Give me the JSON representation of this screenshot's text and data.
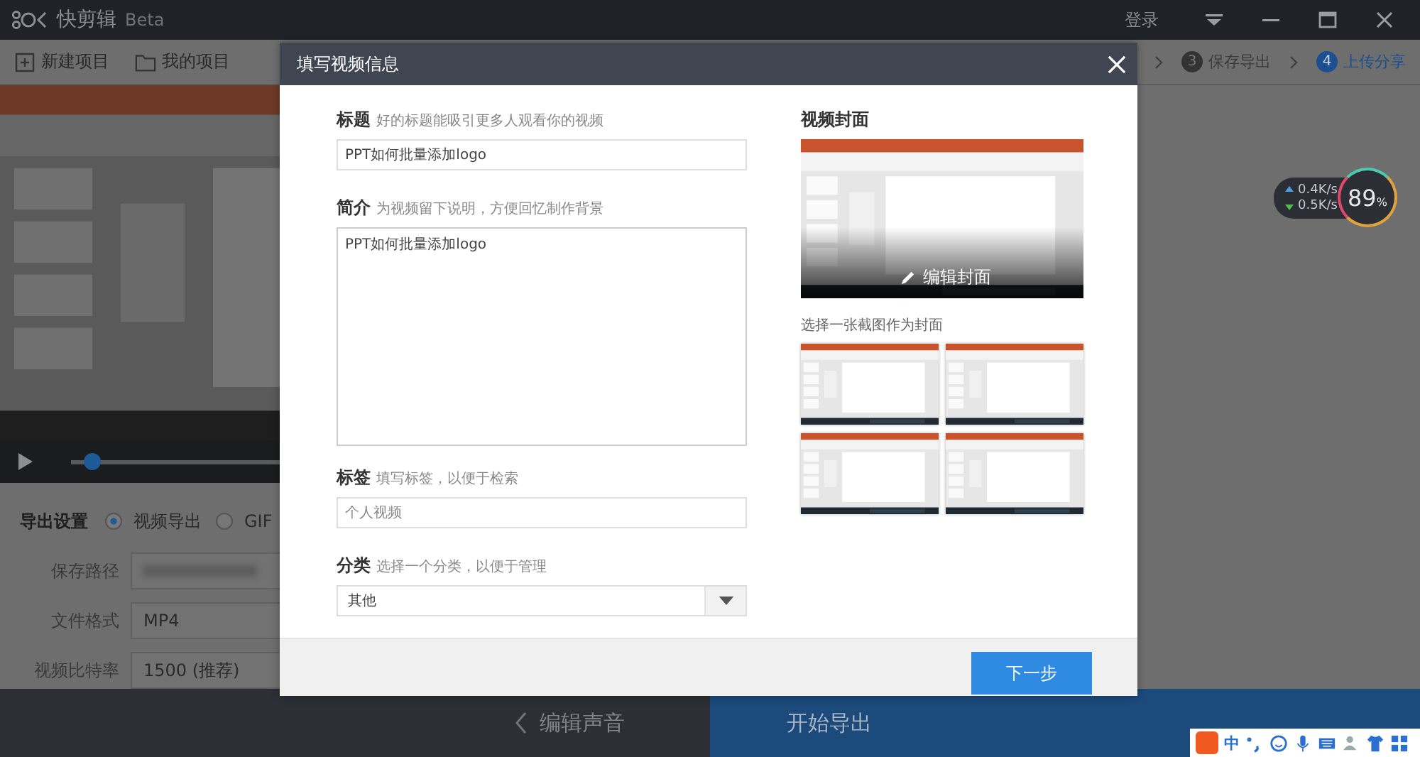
{
  "app": {
    "name": "快剪辑",
    "badge": "Beta",
    "login": "登录"
  },
  "toolbar": {
    "buttons": [
      {
        "label": "新建项目",
        "kind": "new"
      },
      {
        "label": "我的项目",
        "kind": "folder"
      }
    ],
    "steps": [
      {
        "number": "3",
        "label": "保存导出",
        "selected": false
      },
      {
        "number": "4",
        "label": "上传分享",
        "selected": true
      }
    ]
  },
  "player": {
    "level": 0.02
  },
  "export_settings": {
    "title": "导出设置",
    "formats": [
      {
        "label": "视频导出",
        "selected": true
      },
      {
        "label": "GIF",
        "selected": false
      }
    ],
    "fields": [
      {
        "label": "保存路径",
        "kind": "blurred"
      },
      {
        "label": "文件格式",
        "kind": "dropdown",
        "value": "MP4"
      },
      {
        "label": "视频比特率",
        "kind": "dropdown",
        "value": "1500 (推荐)"
      }
    ]
  },
  "bottom_bar": {
    "back": "编辑声音",
    "export": "开始导出"
  },
  "network_widget": {
    "upload": "0.4K/s",
    "download": "0.5K/s",
    "percent": "89",
    "unit": "%"
  },
  "dialog": {
    "title": "填写视频信息",
    "fields": [
      {
        "label": "标题",
        "hint": "好的标题能吸引更多人观看你的视频",
        "kind": "input",
        "value": "PPT如何批量添加logo"
      },
      {
        "label": "简介",
        "hint": "为视频留下说明，方便回忆制作背景",
        "kind": "textarea",
        "value": "PPT如何批量添加logo"
      },
      {
        "label": "标签",
        "hint": "填写标签，以便于检索",
        "kind": "input",
        "placeholder": "个人视频"
      },
      {
        "label": "分类",
        "hint": "选择一个分类，以便于管理",
        "kind": "select",
        "value": "其他"
      }
    ],
    "cover": {
      "title": "视频封面",
      "edit": "编辑封面",
      "choose": "选择一张截图作为封面"
    },
    "next": "下一步"
  },
  "ime": {
    "mode": "中"
  }
}
